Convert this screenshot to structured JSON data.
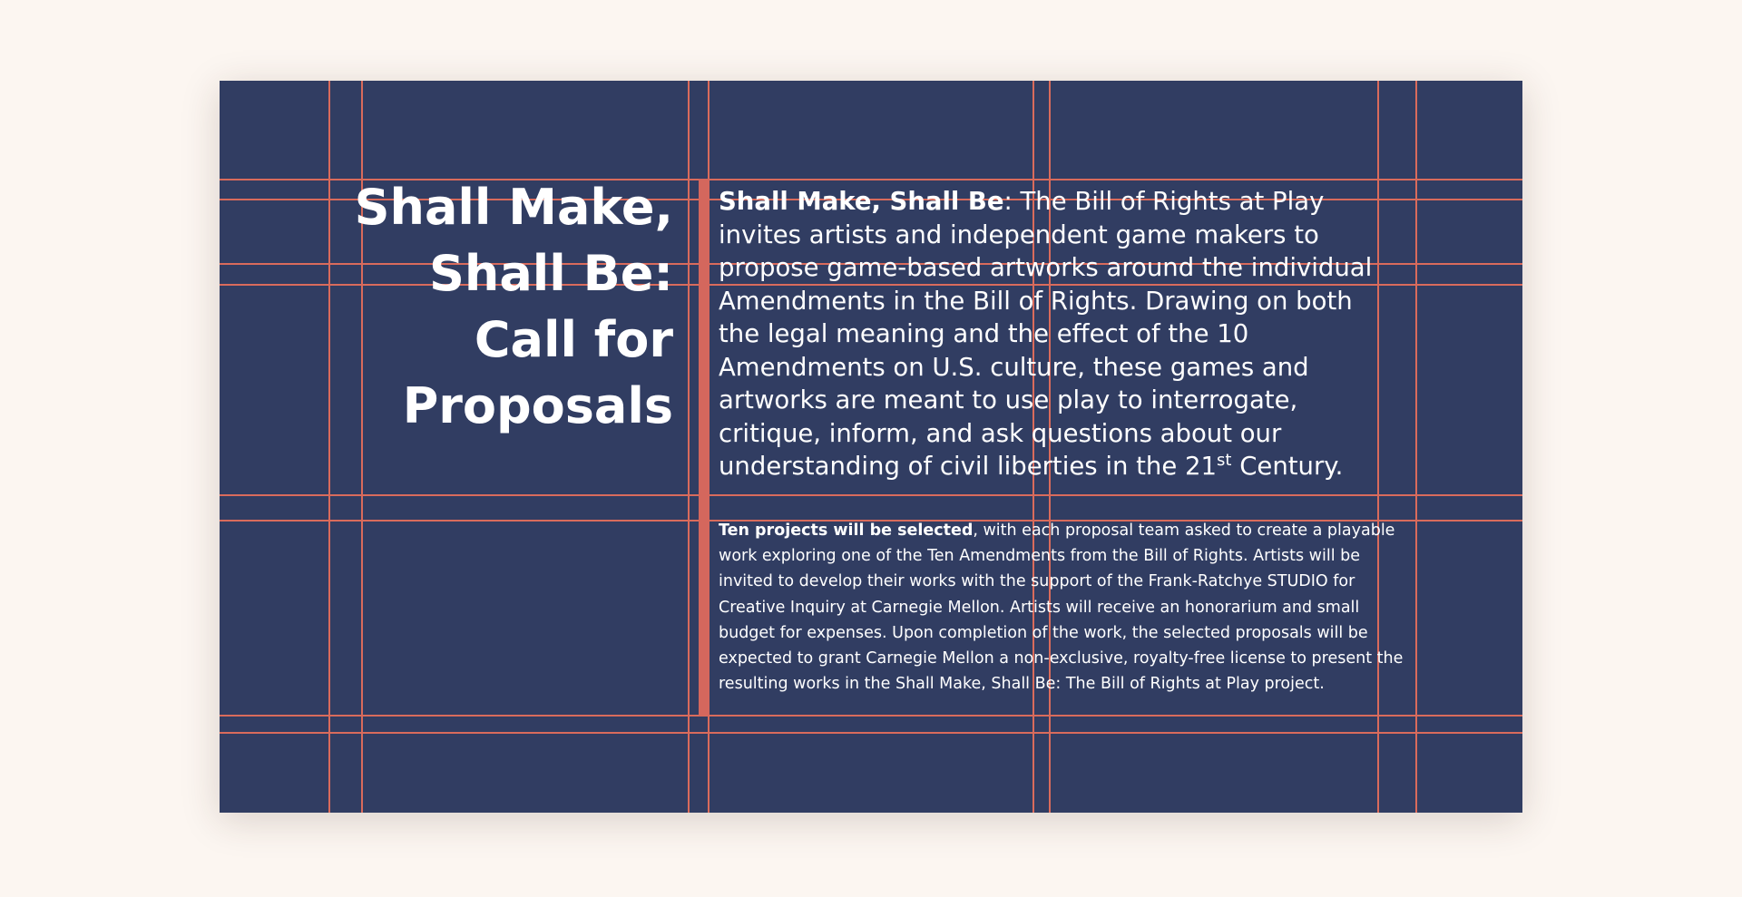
{
  "title": {
    "line1": "Shall Make,",
    "line2": "Shall Be:",
    "line3": "Call for",
    "line4": "Proposals"
  },
  "intro": {
    "lead": "Shall Make, Shall Be",
    "body": ": The Bill of Rights at Play invites artists and independent game makers to propose game-based artworks around the individual Amendments in the Bill of Rights. Drawing on both the legal meaning and the effect of the 10 Amendments on U.S. culture, these games and artworks are meant to use play to interrogate, critique, inform, and ask questions about our understanding of civil liberties in the 21",
    "superscript": "st",
    "tail": " Century."
  },
  "details": {
    "lead": "Ten projects will be selected",
    "body": ", with each proposal team asked to create a playable work exploring one of the Ten Amendments from the Bill of Rights. Artists will be invited to develop their works with the support of the Frank-Ratchye STUDIO for Creative Inquiry at Carnegie Mellon. Artists will receive an honorarium and small budget for expenses. Upon completion of the work, the selected proposals will be expected to grant Carnegie Mellon a non-exclusive, royalty-free license to present the resulting works in the Shall Make, Shall Be: The Bill of Rights at Play project."
  },
  "colors": {
    "page_background": "#fcf6f1",
    "card_background": "#313d62",
    "grid_line": "#d96b5c",
    "accent_bar": "#d4675d",
    "text": "#ffffff"
  }
}
